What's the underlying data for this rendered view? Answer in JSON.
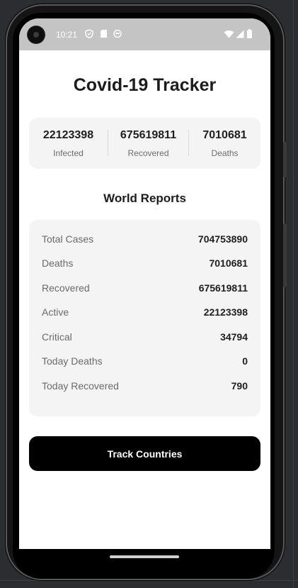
{
  "status_bar": {
    "time": "10:21",
    "icons": [
      "shield-icon",
      "sd-card-icon",
      "face-icon",
      "wifi-icon",
      "signal-icon",
      "battery-icon"
    ]
  },
  "app": {
    "title": "Covid-19 Tracker"
  },
  "summary": [
    {
      "value": "22123398",
      "label": "Infected"
    },
    {
      "value": "675619811",
      "label": "Recovered"
    },
    {
      "value": "7010681",
      "label": "Deaths"
    }
  ],
  "world_reports": {
    "title": "World Reports",
    "rows": [
      {
        "label": "Total Cases",
        "value": "704753890"
      },
      {
        "label": "Deaths",
        "value": "7010681"
      },
      {
        "label": "Recovered",
        "value": "675619811"
      },
      {
        "label": "Active",
        "value": "22123398"
      },
      {
        "label": "Critical",
        "value": "34794"
      },
      {
        "label": "Today Deaths",
        "value": "0"
      },
      {
        "label": "Today Recovered",
        "value": "790"
      }
    ]
  },
  "actions": {
    "track_label": "Track Countries"
  },
  "colors": {
    "background": "#ffffff",
    "card": "#f4f4f4",
    "button": "#000000",
    "status_bar": "#c4c4c4"
  }
}
